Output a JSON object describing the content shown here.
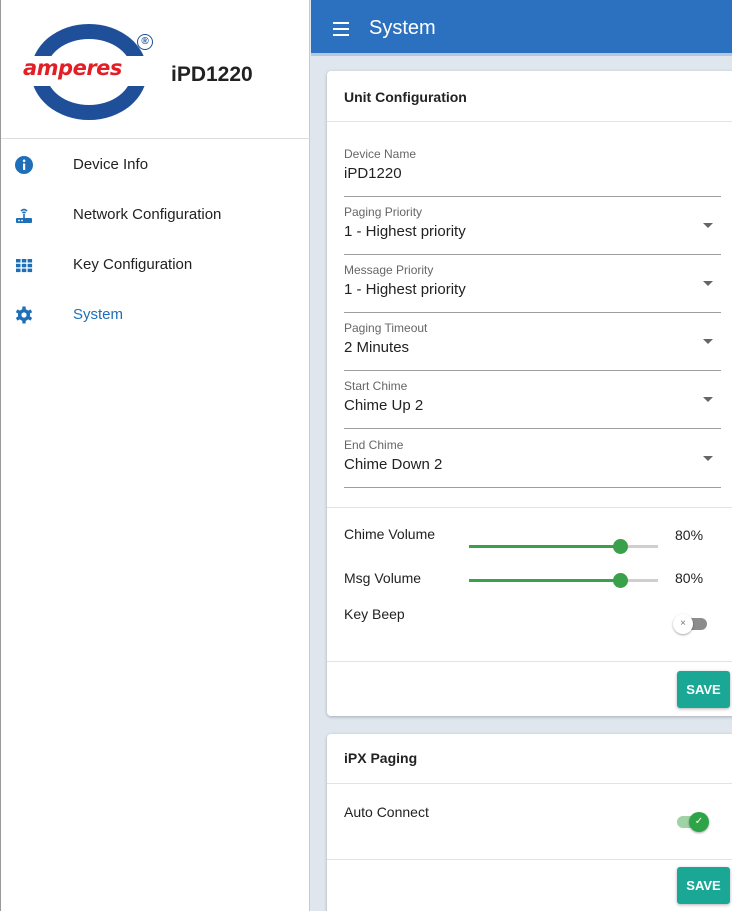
{
  "brand": {
    "logo_text": "amperes",
    "registered_mark": "®",
    "product_name": "iPD1220"
  },
  "sidebar": {
    "items": [
      {
        "label": "Device Info",
        "icon": "info-icon",
        "active": false
      },
      {
        "label": "Network Configuration",
        "icon": "router-icon",
        "active": false
      },
      {
        "label": "Key Configuration",
        "icon": "grid-icon",
        "active": false
      },
      {
        "label": "System",
        "icon": "gear-icon",
        "active": true
      }
    ]
  },
  "header": {
    "title": "System",
    "menu_icon": "hamburger-menu-icon"
  },
  "unit_config": {
    "title": "Unit Configuration",
    "fields": [
      {
        "label": "Device Name",
        "value": "iPD1220",
        "type": "text"
      },
      {
        "label": "Paging Priority",
        "value": "1 - Highest priority",
        "type": "select"
      },
      {
        "label": "Message Priority",
        "value": "1 - Highest priority",
        "type": "select"
      },
      {
        "label": "Paging Timeout",
        "value": "2 Minutes",
        "type": "select"
      },
      {
        "label": "Start Chime",
        "value": "Chime Up 2",
        "type": "select"
      },
      {
        "label": "End Chime",
        "value": "Chime Down 2",
        "type": "select"
      }
    ],
    "chime_volume": {
      "label": "Chime Volume",
      "value": 80,
      "display": "80%"
    },
    "msg_volume": {
      "label": "Msg Volume",
      "value": 80,
      "display": "80%"
    },
    "key_beep": {
      "label": "Key Beep",
      "enabled": false,
      "knob_glyph": "×"
    },
    "save_label": "SAVE"
  },
  "ipx_paging": {
    "title": "iPX Paging",
    "auto_connect": {
      "label": "Auto Connect",
      "enabled": true,
      "knob_glyph": "✓"
    },
    "save_label": "SAVE"
  },
  "colors": {
    "header": "#2c71bf",
    "accent": "#1e6fb8",
    "slider": "#3aa04a",
    "button": "#1ba796",
    "logo_blue": "#1f4f99",
    "logo_red": "#e21f26"
  }
}
